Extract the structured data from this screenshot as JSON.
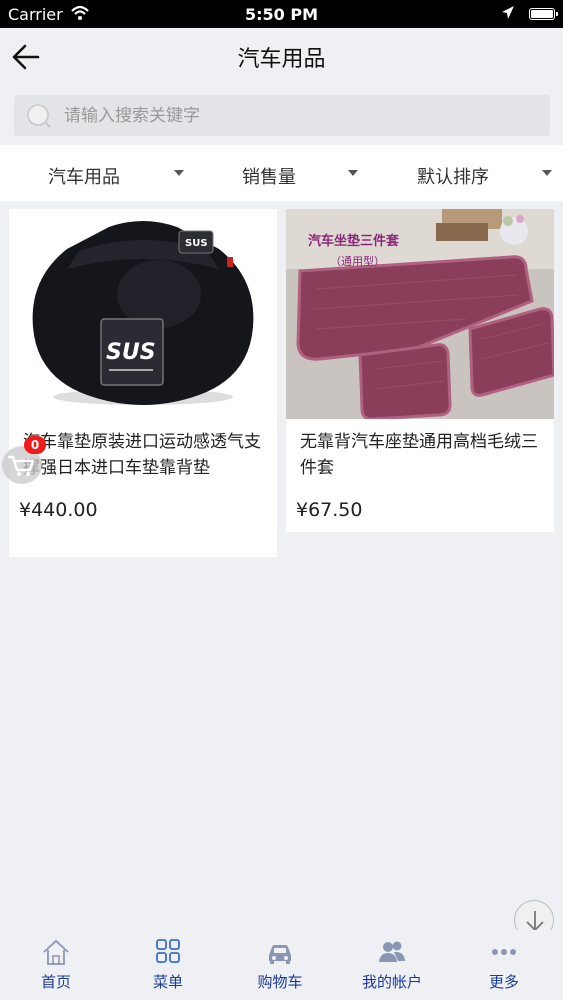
{
  "status_bar": {
    "carrier": "Carrier",
    "time": "5:50 PM"
  },
  "header": {
    "title": "汽车用品"
  },
  "search": {
    "placeholder": "请输入搜索关键字"
  },
  "filters": [
    {
      "label": "汽车用品"
    },
    {
      "label": "销售量"
    },
    {
      "label": "默认排序"
    }
  ],
  "products": [
    {
      "name": "汽车靠垫原装进口运动感透气支撑强日本进口车垫靠背垫",
      "price": "¥440.00"
    },
    {
      "name": "无靠背汽车座垫通用高档毛绒三件套",
      "price": "¥67.50",
      "image_caption": "汽车坐垫三件套",
      "image_subcaption": "（通用型）"
    }
  ],
  "cart": {
    "badge_count": "0"
  },
  "tabbar": [
    {
      "label": "首页",
      "icon": "home-icon"
    },
    {
      "label": "菜单",
      "icon": "grid-icon"
    },
    {
      "label": "购物车",
      "icon": "car-icon"
    },
    {
      "label": "我的帐户",
      "icon": "users-icon"
    },
    {
      "label": "更多",
      "icon": "more-icon"
    }
  ],
  "colors": {
    "accent": "#1a3a9c",
    "badge": "#f01c1c",
    "background": "#eef0f3"
  }
}
